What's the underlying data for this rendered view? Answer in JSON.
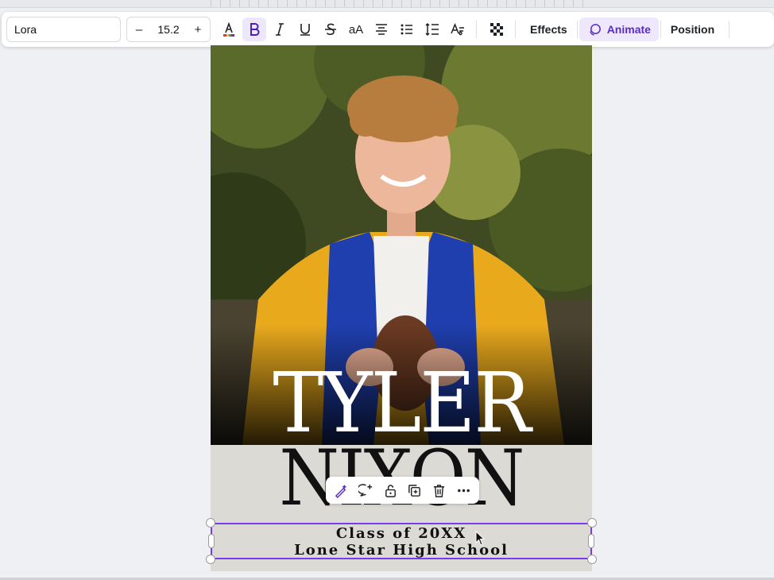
{
  "toolbar": {
    "font_name": "Lora",
    "font_size": "15.2",
    "decrease_label": "–",
    "increase_label": "+",
    "case_label": "aA",
    "effects_label": "Effects",
    "animate_label": "Animate",
    "position_label": "Position"
  },
  "design": {
    "first_name": "TYLER",
    "last_name": "NIXON",
    "class_line": "Class of 20XX",
    "school_line": "Lone Star High School"
  },
  "colors": {
    "accent": "#7c3aed",
    "active_bg": "#ede7fb",
    "page_bg": "#dcdad5"
  },
  "icons": [
    "text-color-icon",
    "bold-icon",
    "italic-icon",
    "underline-icon",
    "strikethrough-icon",
    "letter-case-icon",
    "align-center-icon",
    "bullet-list-icon",
    "spacing-icon",
    "text-effects-icon",
    "transparency-icon",
    "magic-edit-icon",
    "comment-icon",
    "lock-icon",
    "duplicate-icon",
    "trash-icon",
    "more-icon"
  ]
}
